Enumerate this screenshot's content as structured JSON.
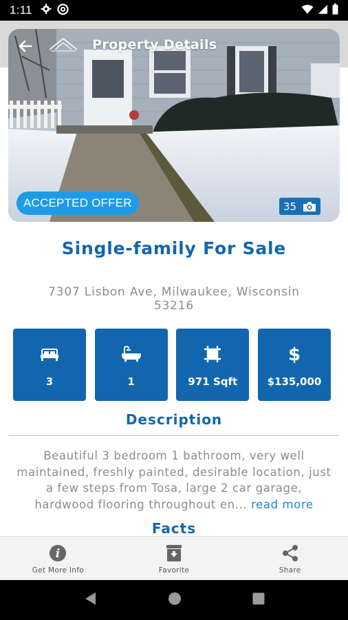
{
  "status_bar": {
    "time": "1:11",
    "left_icons": [
      "gear-icon",
      "at-sign-icon"
    ],
    "right_icons": [
      "wifi-icon",
      "signal-icon",
      "battery-icon"
    ]
  },
  "header": {
    "title": "Property Details",
    "back_icon": "arrow-left-icon",
    "logo_icon": "house-roof-logo-icon"
  },
  "hero": {
    "badge": "ACCEPTED OFFER",
    "photo_count": "35",
    "photo_count_icon": "camera-icon"
  },
  "listing": {
    "type": "Single-family For Sale",
    "address": "7307 Lisbon Ave, Milwaukee, Wisconsin 53216"
  },
  "stats": [
    {
      "icon": "bed-icon",
      "value": "3"
    },
    {
      "icon": "bathtub-icon",
      "value": "1"
    },
    {
      "icon": "area-icon",
      "value": "971 Sqft"
    },
    {
      "icon": "dollar-icon",
      "value": "$135,000"
    }
  ],
  "description": {
    "heading": "Description",
    "text": "Beautiful 3 bedroom 1 bathroom, very well maintained, freshly painted, desirable location, just a few steps from Tosa, large 2 car garage, hardwood flooring throughout en...",
    "read_more": "read more"
  },
  "facts": {
    "heading": "Facts"
  },
  "actions": [
    {
      "icon": "info-icon",
      "label": "Get More Info"
    },
    {
      "icon": "favorite-box-icon",
      "label": "Favorite"
    },
    {
      "icon": "share-icon",
      "label": "Share"
    }
  ],
  "colors": {
    "primary": "#1266ae",
    "badge": "#1e9be6",
    "link": "#1e86d6",
    "muted_text": "#8c8c8c"
  }
}
